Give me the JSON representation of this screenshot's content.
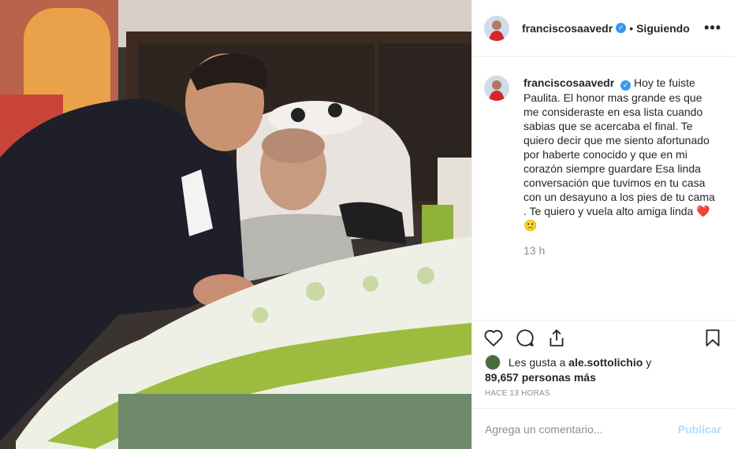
{
  "post": {
    "photo_alt": "Foto de la publicación",
    "header": {
      "username": "franciscosaavedr",
      "verified_mark": "✓",
      "separator": "•",
      "follow_status": "Siguiendo",
      "more_icon": "more-options-icon",
      "more_glyph": "•••"
    },
    "caption": {
      "username": "franciscosaavedr",
      "text": "Hoy te fuiste Paulita. El honor mas grande es que me consideraste en esa lista cuando sabias que se acercaba el final. Te quiero decir que me siento afortunado por haberte conocido y que en mi corazón siempre guardare Esa linda conversación que tuvimos en tu casa con un desayuno a los pies de tu cama . Te quiero y vuela alto amiga linda",
      "emoji": "❤️🙁",
      "time": "13 h"
    },
    "actions": {
      "like_icon": "heart-icon",
      "comment_icon": "comment-icon",
      "share_icon": "share-icon",
      "save_icon": "bookmark-icon"
    },
    "likes": {
      "prefix": "Les gusta a",
      "liker": "ale.sottolichio",
      "connector": "y",
      "count_text": "89,657 personas más"
    },
    "ago": "HACE 13 HORAS",
    "comment_box": {
      "placeholder": "Agrega un comentario...",
      "value": "",
      "publish_label": "Publicar"
    },
    "colors": {
      "verified": "#3897f0",
      "publish_disabled": "#b3dbff",
      "muted": "#8e8e8e",
      "text": "#262626"
    }
  }
}
